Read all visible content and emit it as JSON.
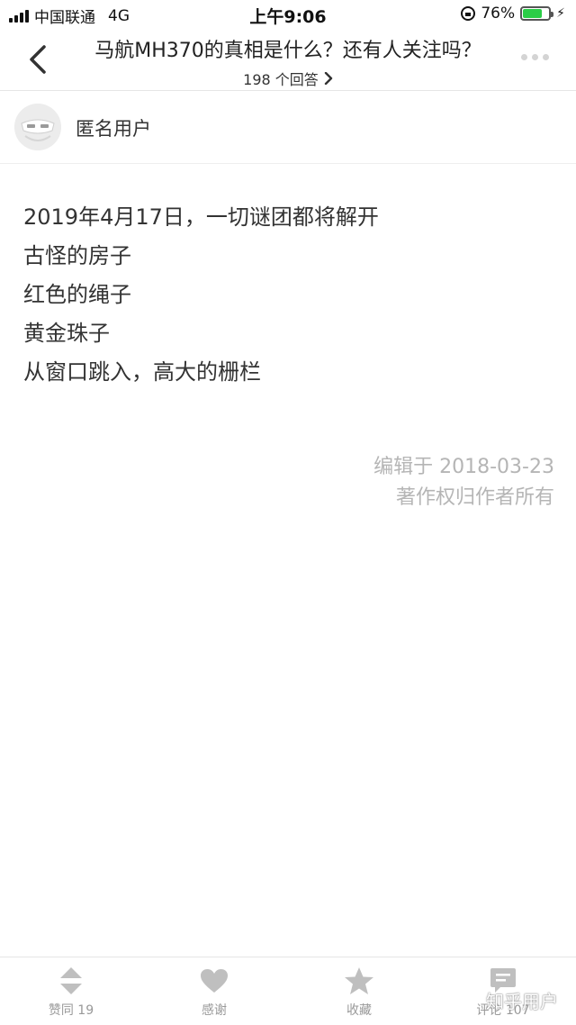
{
  "status_bar": {
    "carrier": "中国联通",
    "network": "4G",
    "time": "上午9:06",
    "battery_percent": "76%",
    "battery_level": 0.76,
    "icons": [
      "signal-icon",
      "orientation-lock-icon",
      "battery-icon",
      "charging-icon"
    ],
    "battery_color": "#2bcd47"
  },
  "nav": {
    "back_icon": "chevron-left-icon",
    "title": "马航MH370的真相是什么？还有人关注吗？",
    "subtitle": "198 个回答",
    "subtitle_icon": "chevron-right-icon",
    "more_icon": "more-dots-icon"
  },
  "author": {
    "name": "匿名用户",
    "avatar_icon": "anonymous-avatar-icon"
  },
  "answer": {
    "lines": [
      "2019年4月17日，一切谜团都将解开",
      "古怪的房子",
      "红色的绳子",
      "黄金珠子",
      "从窗口跳入，高大的栅栏"
    ],
    "edited": "编辑于 2018-03-23",
    "copyright": "著作权归作者所有"
  },
  "bottom_bar": {
    "items": [
      {
        "label": "赞同 19",
        "icon": "vote-arrows-icon"
      },
      {
        "label": "感谢",
        "icon": "heart-icon"
      },
      {
        "label": "收藏",
        "icon": "star-icon"
      },
      {
        "label": "评论 107",
        "icon": "comment-icon"
      }
    ],
    "icon_color": "#bfbfbf"
  },
  "watermark": "知乎用户"
}
